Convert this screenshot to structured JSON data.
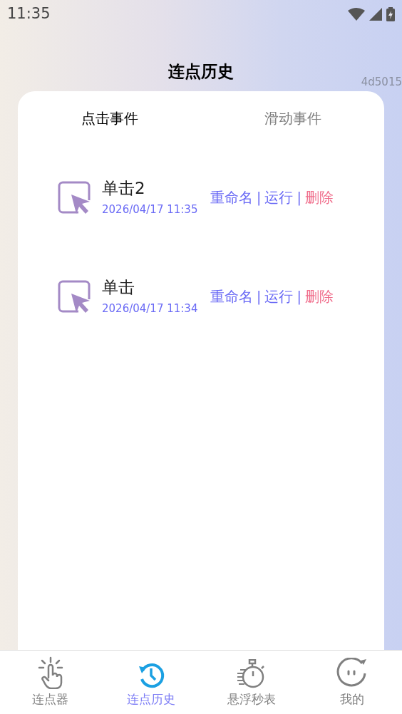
{
  "status_bar": {
    "time": "11:35"
  },
  "header": {
    "title": "连点历史",
    "code": "4d5015"
  },
  "tabs": [
    {
      "label": "点击事件",
      "selected": true
    },
    {
      "label": "滑动事件",
      "selected": false
    }
  ],
  "records": [
    {
      "name": "单击2",
      "time": "2026/04/17 11:35",
      "actions": [
        {
          "kind": "link",
          "label": "重命名",
          "color": "#6a6af5"
        },
        {
          "kind": "separator",
          "label": "|"
        },
        {
          "kind": "link",
          "label": "运行",
          "color": "#6a6af5"
        },
        {
          "kind": "separator",
          "label": "|"
        },
        {
          "kind": "link",
          "label": "删除",
          "color": "#f06e8c"
        }
      ]
    },
    {
      "name": "单击",
      "time": "2026/04/17 11:34",
      "actions": [
        {
          "kind": "link",
          "label": "重命名",
          "color": "#6a6af5"
        },
        {
          "kind": "separator",
          "label": "|"
        },
        {
          "kind": "link",
          "label": "运行",
          "color": "#6a6af5"
        },
        {
          "kind": "separator",
          "label": "|"
        },
        {
          "kind": "link",
          "label": "删除",
          "color": "#f06e8c"
        }
      ]
    }
  ],
  "bottom_nav": [
    {
      "kind": "clicker",
      "label": "连点器",
      "selected": false
    },
    {
      "kind": "history",
      "label": "连点历史",
      "selected": true
    },
    {
      "kind": "stopwatch",
      "label": "悬浮秒表",
      "selected": false
    },
    {
      "kind": "profile",
      "label": "我的",
      "selected": false
    }
  ]
}
